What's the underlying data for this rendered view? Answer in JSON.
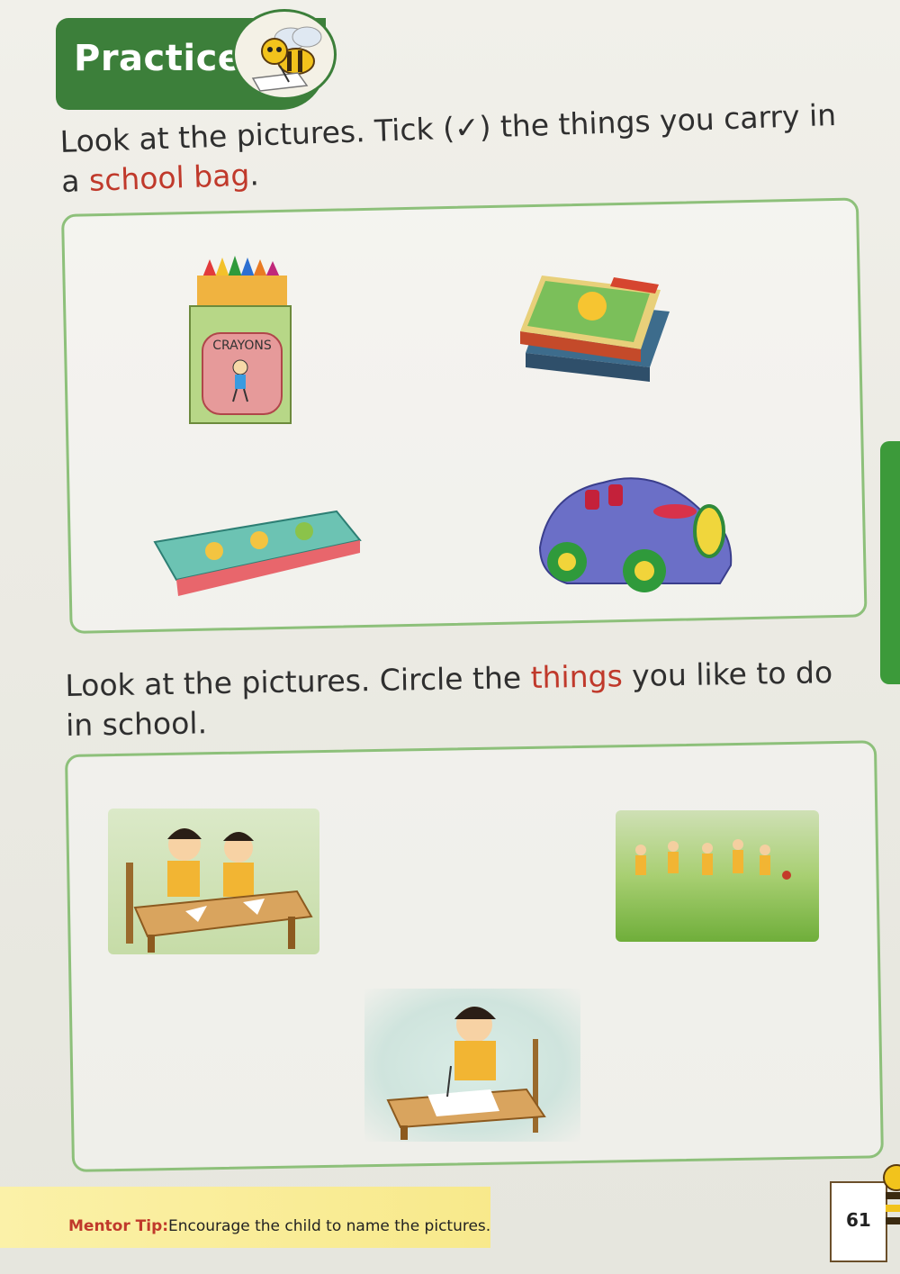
{
  "header": {
    "title": "Practice"
  },
  "section1": {
    "instruction_before_paren": "Look at the pictures. Tick (",
    "tick_symbol": "✓",
    "instruction_after_paren": ") the things you carry in",
    "instruction_line2_prefix": "a ",
    "instruction_highlight": "school bag",
    "instruction_end": ".",
    "crayon_box_label": "CRAYONS"
  },
  "section2": {
    "instruction_prefix": "Look at the pictures. Circle the ",
    "instruction_highlight": "things",
    "instruction_suffix": " you like to do",
    "instruction_line2": "in school."
  },
  "footer": {
    "mentor_label": "Mentor Tip:",
    "mentor_text": "Encourage the child to name the pictures.",
    "page_number": "61"
  }
}
